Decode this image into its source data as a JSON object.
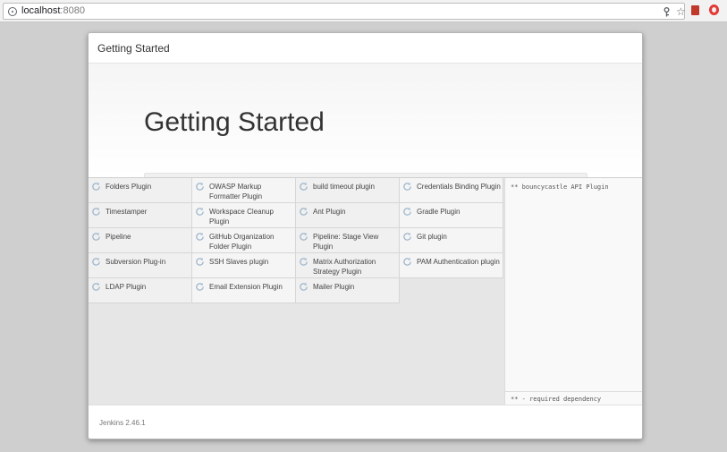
{
  "browser": {
    "url_host": "localhost",
    "url_port": ":8080"
  },
  "modal": {
    "header_title": "Getting Started",
    "hero_title": "Getting Started",
    "progress": 0
  },
  "plugins": [
    [
      "Folders Plugin",
      "OWASP Markup Formatter Plugin",
      "build timeout plugin",
      "Credentials Binding Plugin"
    ],
    [
      "Timestamper",
      "Workspace Cleanup Plugin",
      "Ant Plugin",
      "Gradle Plugin"
    ],
    [
      "Pipeline",
      "GitHub Organization Folder Plugin",
      "Pipeline: Stage View Plugin",
      "Git plugin"
    ],
    [
      "Subversion Plug-in",
      "SSH Slaves plugin",
      "Matrix Authorization Strategy Plugin",
      "PAM Authentication plugin"
    ],
    [
      "LDAP Plugin",
      "Email Extension Plugin",
      "Mailer Plugin"
    ]
  ],
  "log": {
    "line": "** bouncycastle API Plugin",
    "footer": "** - required dependency"
  },
  "footer": {
    "version": "Jenkins 2.46.1"
  },
  "icons": {
    "spinner": "refresh-icon",
    "key": "key-icon",
    "star": "star-icon"
  },
  "colors": {
    "spinner": "#9fb7cc",
    "background": "#cfcfcf"
  }
}
